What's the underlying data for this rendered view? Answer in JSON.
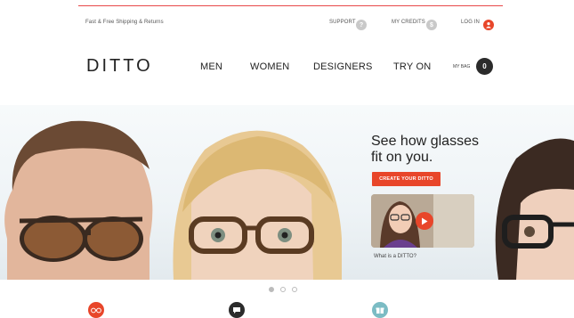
{
  "header": {
    "shipping_text": "Fast & Free Shipping & Returns",
    "support_label": "SUPPORT",
    "credits_label": "MY CREDITS",
    "login_label": "LOG IN",
    "support_icon": "?",
    "credits_icon": "$"
  },
  "nav": {
    "logo": "DITTO",
    "items": [
      "MEN",
      "WOMEN",
      "DESIGNERS",
      "TRY ON"
    ],
    "bag_label": "MY BAG",
    "bag_count": "0"
  },
  "hero": {
    "headline_line1": "See how glasses",
    "headline_line2": "fit on you.",
    "cta_label": "CREATE YOUR DITTO",
    "video_caption": "What is a DITTO?"
  },
  "carousel": {
    "slides": 3,
    "active_index": 0
  },
  "colors": {
    "accent": "#e8462a",
    "dark": "#2b2b2b",
    "teal": "#7bbcc4",
    "rule": "#e8484a"
  },
  "icons": [
    "question-icon",
    "credits-icon",
    "user-icon",
    "play-icon",
    "glasses-icon",
    "chat-icon",
    "gift-icon"
  ]
}
